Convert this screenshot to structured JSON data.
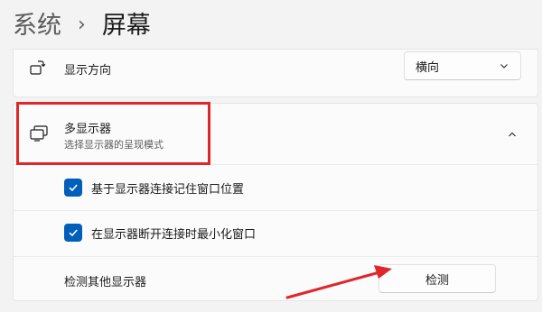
{
  "breadcrumb": {
    "parent": "系统",
    "current": "屏幕"
  },
  "orientation": {
    "label": "显示方向",
    "value": "横向",
    "icon": "screen-rotate-icon"
  },
  "multi_display": {
    "title": "多显示器",
    "subtitle": "选择显示器的呈现模式",
    "icon": "multiple-displays-icon",
    "expanded": true
  },
  "options": {
    "remember_label": "基于显示器连接记住窗口位置",
    "remember_checked": true,
    "minimize_label": "在显示器断开连接时最小化窗口",
    "minimize_checked": true
  },
  "detect": {
    "label": "检测其他显示器",
    "button": "检测"
  },
  "colors": {
    "accent": "#005fb8",
    "annotation_red": "#e0262b"
  }
}
